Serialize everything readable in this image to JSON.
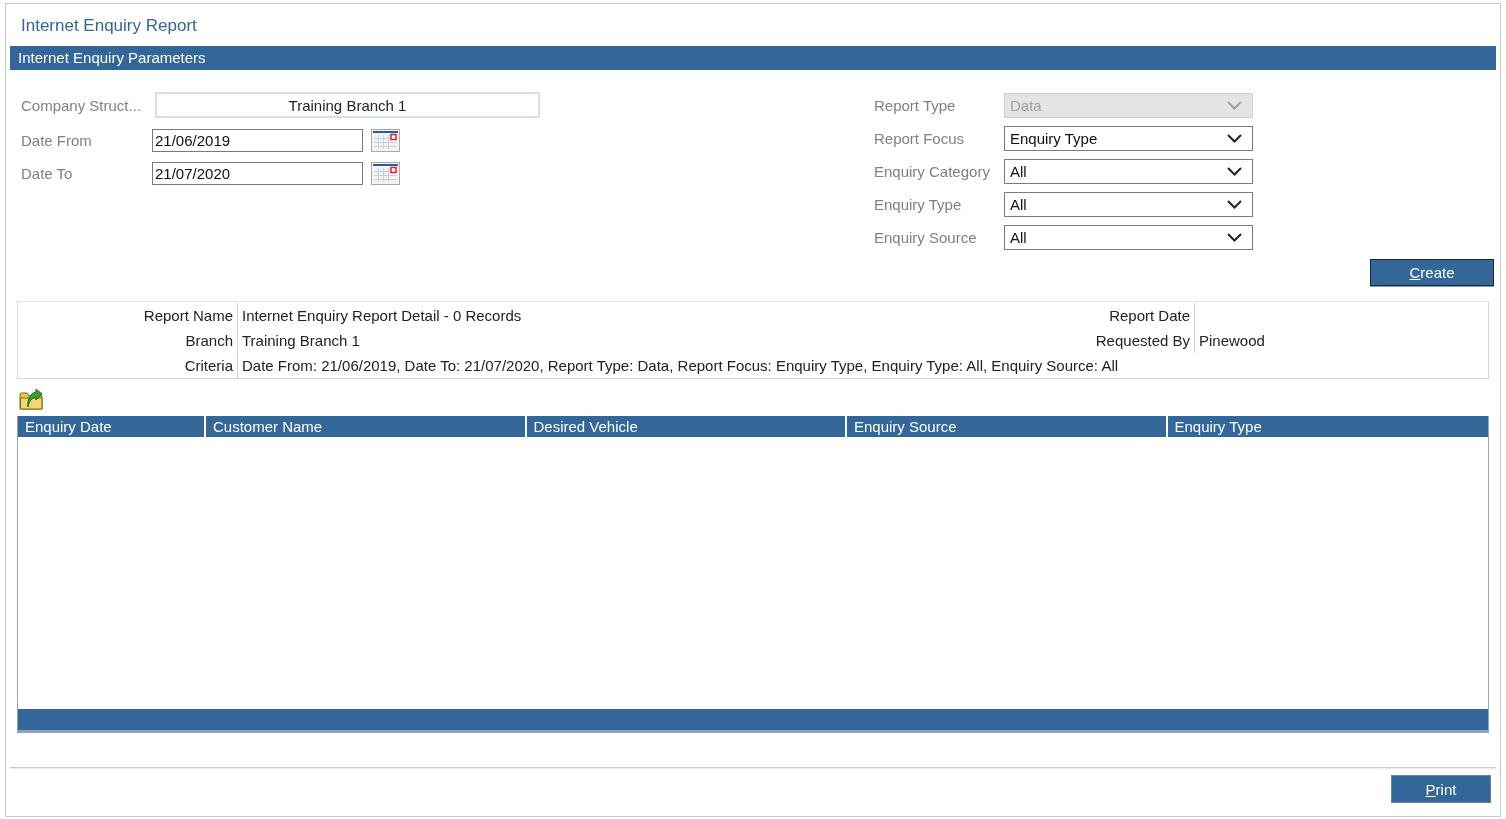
{
  "page": {
    "title": "Internet Enquiry Report"
  },
  "parameters": {
    "title": "Internet Enquiry Parameters",
    "left_fields": [
      {
        "kind": "picker",
        "label": "Company Struct...",
        "value": "Training Branch 1"
      },
      {
        "kind": "date",
        "label": "Date From",
        "value": "21/06/2019"
      },
      {
        "kind": "date",
        "label": "Date To",
        "value": "21/07/2020"
      }
    ],
    "right_fields": [
      {
        "label": "Report Type",
        "value": "Data",
        "disabled": true
      },
      {
        "label": "Report Focus",
        "value": "Enquiry Type",
        "disabled": false
      },
      {
        "label": "Enquiry Category",
        "value": "All",
        "disabled": false
      },
      {
        "label": "Enquiry Type",
        "value": "All",
        "disabled": false
      },
      {
        "label": "Enquiry Source",
        "value": "All",
        "disabled": false
      }
    ],
    "create_button": "Create"
  },
  "report_info": {
    "left": [
      {
        "label": "Report Name",
        "value": "Internet Enquiry Report Detail - 0 Records"
      },
      {
        "label": "Branch",
        "value": "Training Branch 1"
      },
      {
        "label": "Criteria",
        "value": "Date From: 21/06/2019, Date To: 21/07/2020, Report Type: Data, Report Focus: Enquiry Type, Enquiry Type: All, Enquiry Source: All"
      }
    ],
    "right": [
      {
        "label": "Report Date"
      },
      {
        "label": "Requested By",
        "value": "Pinewood"
      }
    ]
  },
  "grid": {
    "columns": [
      "Enquiry Date",
      "Customer Name",
      "Desired Vehicle",
      "Enquiry Source",
      "Enquiry Type"
    ]
  },
  "footer": {
    "print_button": "Print"
  }
}
